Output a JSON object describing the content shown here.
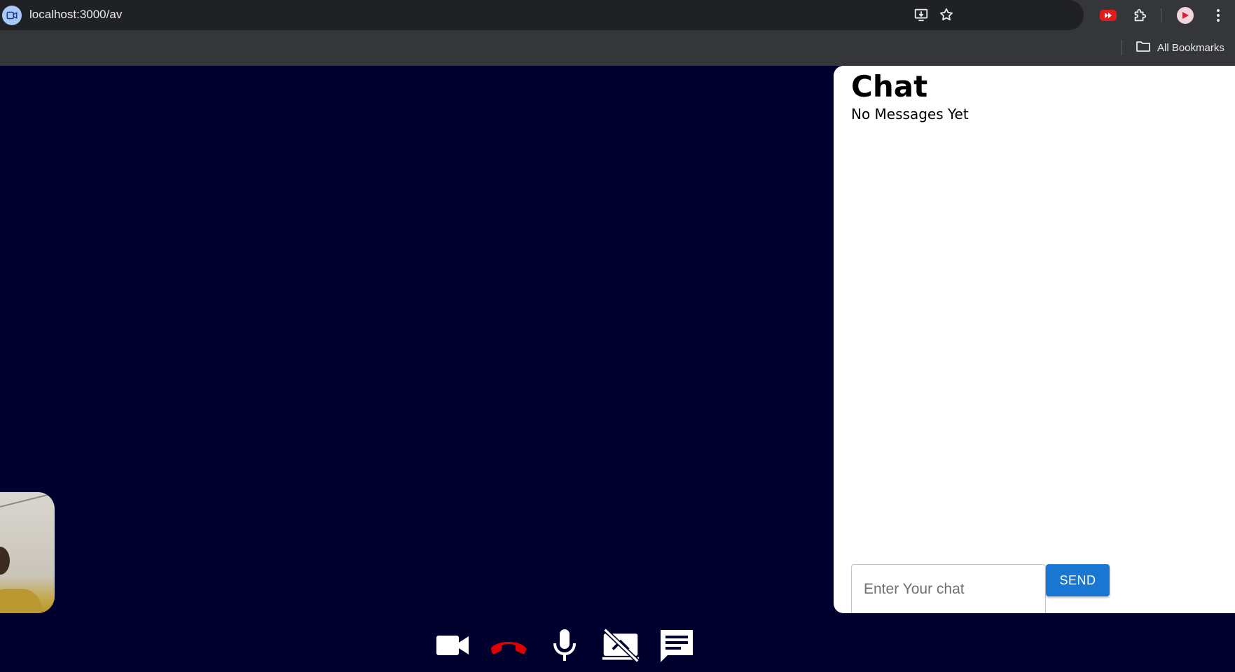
{
  "browser": {
    "url": "localhost:3000/av",
    "bookmarks_label": "All Bookmarks",
    "icons": [
      "video-call-site-icon",
      "install-icon",
      "star-icon",
      "youtube-extension-icon",
      "puzzle-icon",
      "avatar-icon",
      "more-vert-icon",
      "folder-icon"
    ]
  },
  "chat": {
    "title": "Chat",
    "empty_text": "No Messages Yet",
    "input_placeholder": "Enter Your chat",
    "send_label": "SEND"
  },
  "controls": {
    "icons": [
      "videocam-icon",
      "call-end-icon",
      "mic-icon",
      "screen-share-off-icon",
      "chat-icon"
    ]
  },
  "colors": {
    "stage_background": "#00002e",
    "hangup": "#e00000",
    "send_button": "#1976d2"
  }
}
